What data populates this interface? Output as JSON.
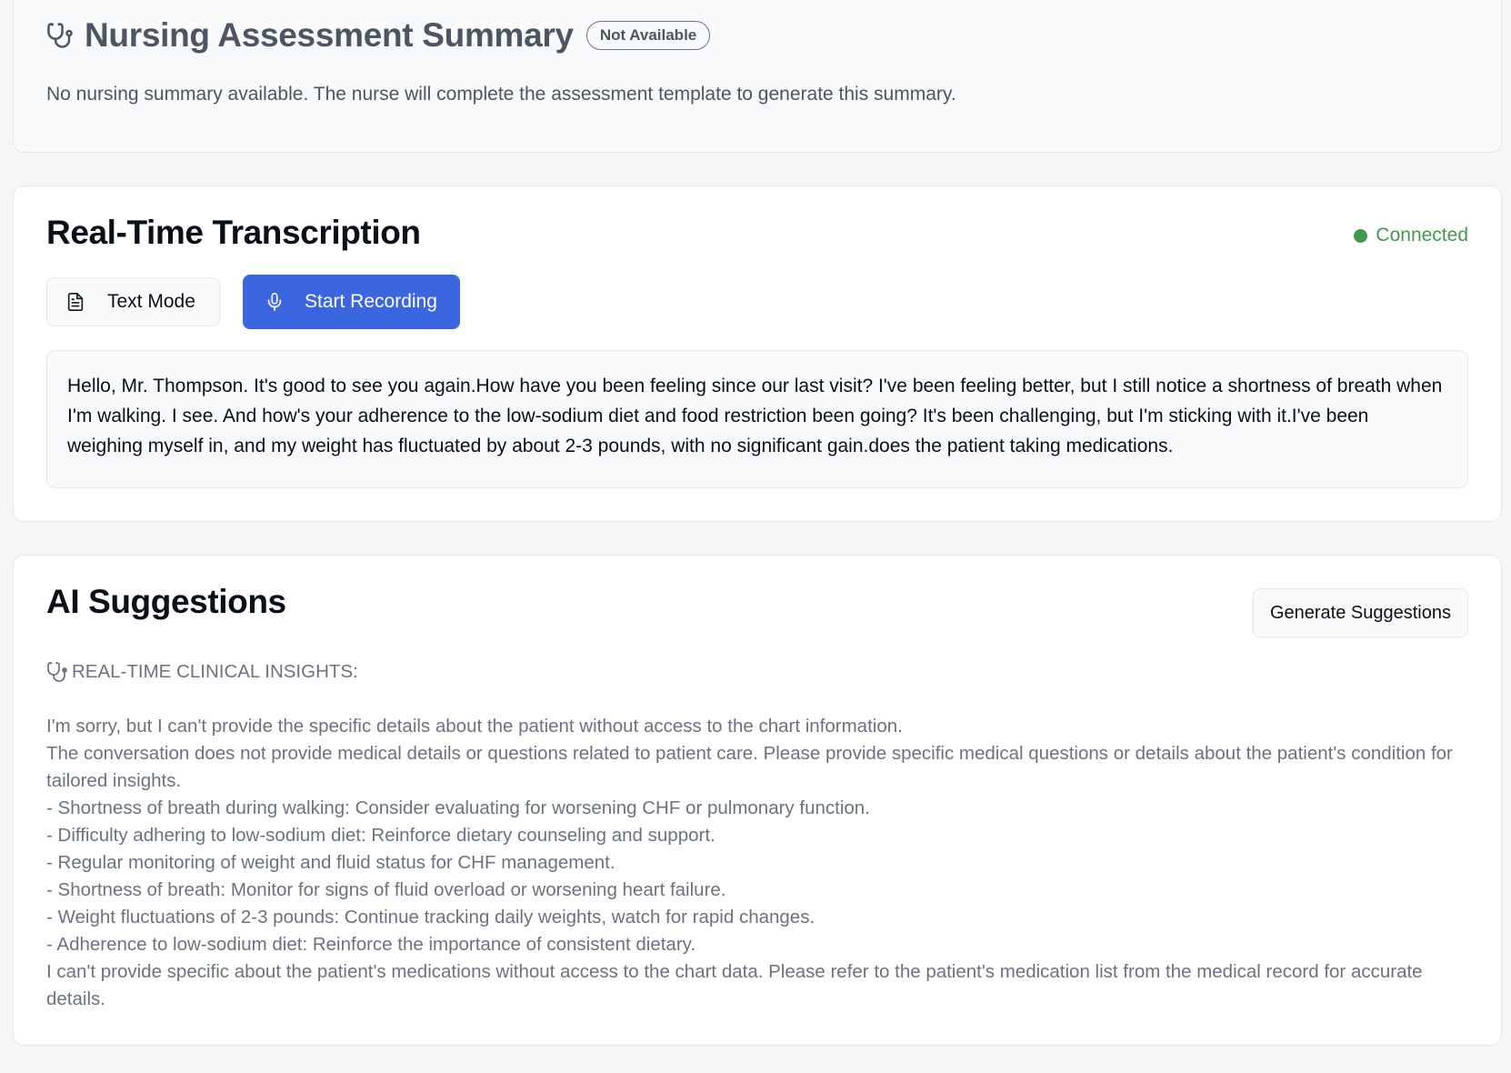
{
  "nursing": {
    "icon": "stethoscope-icon",
    "title": "Nursing Assessment Summary",
    "badge": "Not Available",
    "message": "No nursing summary available. The nurse will complete the assessment template to generate this summary."
  },
  "transcription": {
    "title": "Real-Time Transcription",
    "status": "Connected",
    "status_color": "#3f9a4e",
    "text_mode_label": "Text Mode",
    "text_mode_icon": "document-icon",
    "record_label": "Start Recording",
    "record_icon": "microphone-icon",
    "accent": "#3b66e0",
    "transcript": "Hello, Mr. Thompson. It's good to see you again.How have you been feeling since our last visit? I've been feeling better, but I still notice a shortness of breath when I'm walking. I see. And how's your adherence to the low-sodium diet and food restriction been going? It's been challenging, but I'm sticking with it.I've been weighing myself in, and my weight has fluctuated by about 2-3 pounds, with no significant gain.does the patient taking medications."
  },
  "ai": {
    "title": "AI Suggestions",
    "generate_label": "Generate Suggestions",
    "heading_icon": "stethoscope-emoji-icon",
    "heading": "REAL-TIME CLINICAL INSIGHTS:",
    "lines": [
      "I'm sorry, but I can't provide the specific details about the patient without access to the chart information.",
      "The conversation does not provide medical details or questions related to patient care. Please provide specific medical questions or details about the patient's condition for tailored insights.",
      "- Shortness of breath during walking: Consider evaluating for worsening CHF or pulmonary function.",
      "- Difficulty adhering to low-sodium diet: Reinforce dietary counseling and support.",
      "- Regular monitoring of weight and fluid status for CHF management.",
      "- Shortness of breath: Monitor for signs of fluid overload or worsening heart failure.",
      "- Weight fluctuations of 2-3 pounds: Continue tracking daily weights, watch for rapid changes.",
      "- Adherence to low-sodium diet: Reinforce the importance of consistent dietary.",
      "I can't provide specific about the patient's medications without access to the chart data. Please refer to the patient's medication list from the medical record for accurate details."
    ]
  }
}
